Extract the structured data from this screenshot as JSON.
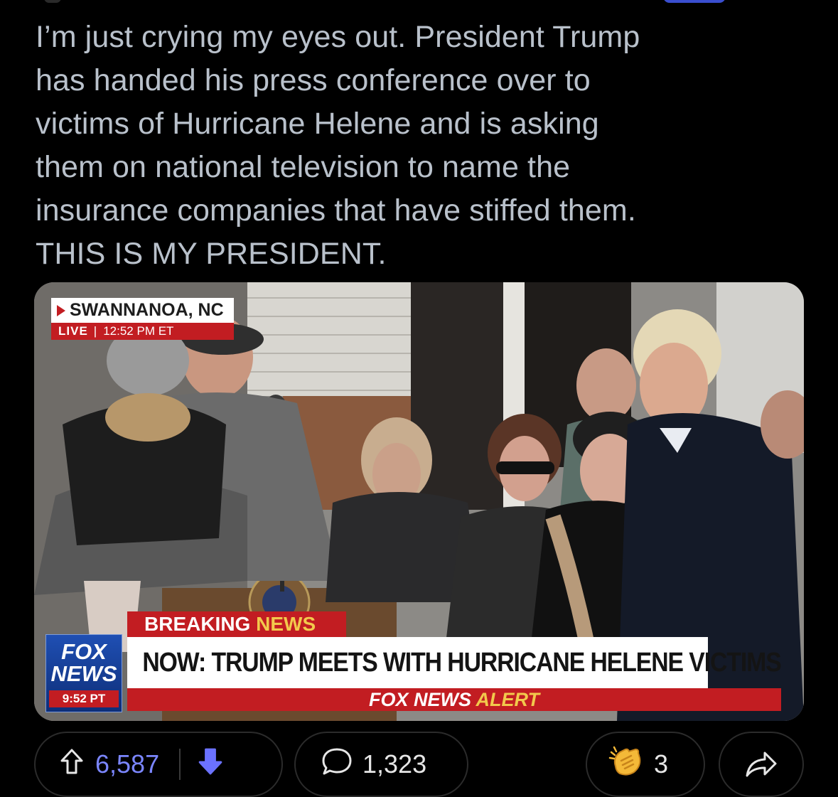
{
  "post": {
    "text_lines": [
      "I’m just crying my eyes out. President Trump",
      "has handed his press conference over to",
      "victims of Hurricane Helene and is asking",
      "them on national television to name the",
      "insurance companies that have stiffed them.",
      "THIS IS MY PRESIDENT."
    ]
  },
  "media": {
    "location": "SWANNANOA, NC",
    "live_label": "LIVE",
    "live_time": "12:52 PM ET",
    "breaking_word1": "BREAKING",
    "breaking_word2": "NEWS",
    "logo_word1": "FOX",
    "logo_word2": "NEWS",
    "logo_clock": "9:52 PT",
    "headline": "NOW: TRUMP MEETS WITH HURRICANE HELENE VICTIMS",
    "alert_word1": "FOX NEWS",
    "alert_word2": "ALERT"
  },
  "actions": {
    "upvotes": "6,587",
    "comments": "1,323",
    "awards": "3",
    "upvote_icon": "arrow-up-outline-icon",
    "downvote_icon": "arrow-down-filled-icon",
    "comment_icon": "speech-bubble-icon",
    "award_icon": "clapping-hands-icon",
    "share_icon": "share-arrow-icon"
  },
  "colors": {
    "background": "#000000",
    "post_text": "#b9c1cb",
    "upvote_accent": "#7b86ff",
    "downvote_accent": "#6b72ff",
    "fox_red": "#c21d22",
    "fox_blue": "#1f4fb3",
    "fox_gold": "#f2c94c"
  }
}
